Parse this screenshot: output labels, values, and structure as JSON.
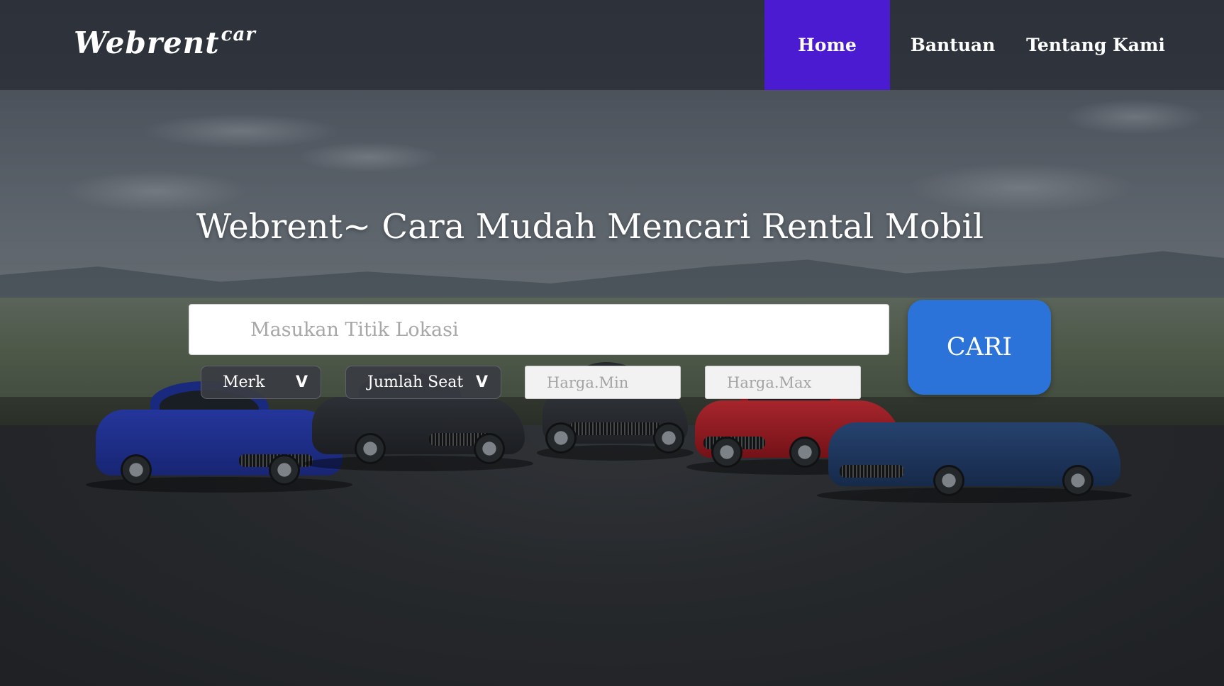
{
  "brand": {
    "name": "Webrent",
    "suffix": "car"
  },
  "nav": {
    "items": [
      {
        "label": "Home",
        "active": true
      },
      {
        "label": "Bantuan",
        "active": false
      },
      {
        "label": "Tentang Kami",
        "active": false
      }
    ]
  },
  "hero": {
    "title": "Webrent~ Cara Mudah Mencari Rental Mobil"
  },
  "search": {
    "placeholder": "Masukan Titik Lokasi",
    "value": "",
    "button_label": "CARI"
  },
  "filters": {
    "merk": {
      "label": "Merk",
      "chevron": "V"
    },
    "seat": {
      "label": "Jumlah Seat",
      "chevron": "V"
    },
    "price_min": {
      "placeholder": "Harga.Min",
      "value": ""
    },
    "price_max": {
      "placeholder": "Harga.Max",
      "value": ""
    }
  },
  "colors": {
    "nav_active": "#4a1bd0",
    "search_button": "#2b73d8",
    "navbar_bg": "#282c34"
  },
  "background": {
    "icon": "car-lineup-landscape-image"
  }
}
